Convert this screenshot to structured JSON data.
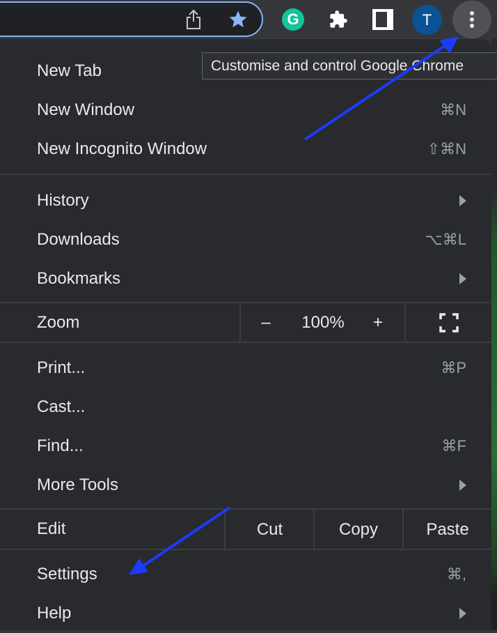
{
  "toolbar": {
    "avatar_letter": "T",
    "icons": [
      "share-icon",
      "bookmark-star-icon",
      "grammarly-icon",
      "extensions-icon",
      "side-panel-icon",
      "profile-avatar",
      "kebab-menu-icon"
    ],
    "accent": "#8ab4f8"
  },
  "tooltip": "Customise and control Google Chrome",
  "menu": {
    "new_tab": {
      "label": "New Tab"
    },
    "new_window": {
      "label": "New Window",
      "shortcut": "⌘N"
    },
    "incognito": {
      "label": "New Incognito Window",
      "shortcut": "⇧⌘N"
    },
    "history": {
      "label": "History"
    },
    "downloads": {
      "label": "Downloads",
      "shortcut": "⌥⌘L"
    },
    "bookmarks": {
      "label": "Bookmarks"
    },
    "zoom": {
      "label": "Zoom",
      "minus": "–",
      "value": "100%",
      "plus": "+"
    },
    "print": {
      "label": "Print...",
      "shortcut": "⌘P"
    },
    "cast": {
      "label": "Cast..."
    },
    "find": {
      "label": "Find...",
      "shortcut": "⌘F"
    },
    "more_tools": {
      "label": "More Tools"
    },
    "edit": {
      "label": "Edit",
      "cut": "Cut",
      "copy": "Copy",
      "paste": "Paste"
    },
    "settings": {
      "label": "Settings",
      "shortcut": "⌘,"
    },
    "help": {
      "label": "Help"
    }
  },
  "annotation_color": "#1a3cff"
}
